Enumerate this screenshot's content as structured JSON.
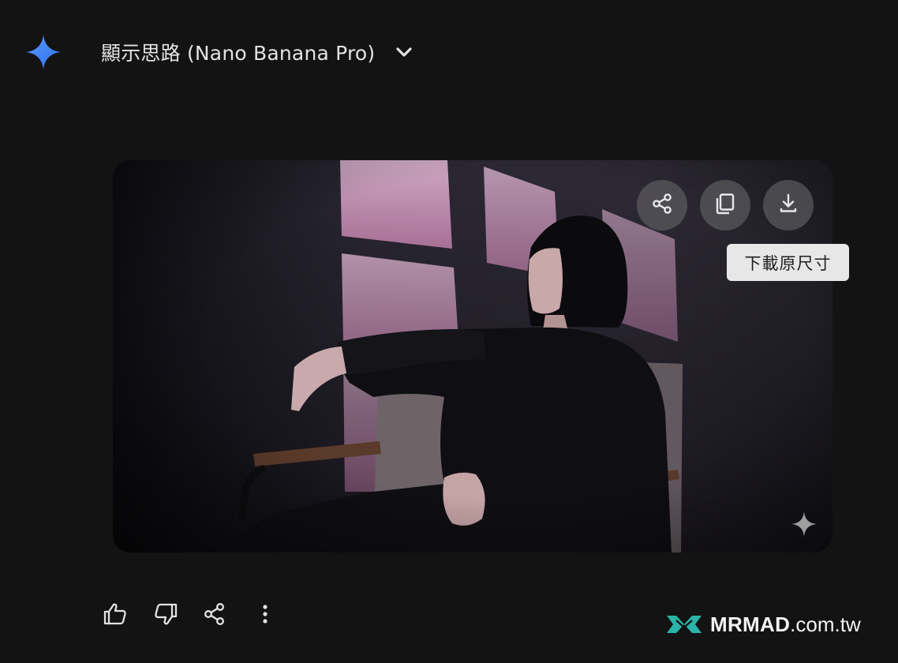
{
  "header": {
    "logo_icon": "gemini-sparkle-icon",
    "thinking_label": "顯示思路 (Nano Banana Pro)",
    "toggle_icon": "chevron-down-icon"
  },
  "image_card": {
    "buttons": [
      {
        "name": "share-image-button",
        "icon": "share-icon"
      },
      {
        "name": "copy-image-button",
        "icon": "copy-icon"
      },
      {
        "name": "download-image-button",
        "icon": "download-icon"
      }
    ],
    "tooltip": "下載原尺寸",
    "watermark_icon": "sparkle-icon"
  },
  "response_actions": [
    {
      "name": "good-response-button",
      "icon": "thumbs-up-icon"
    },
    {
      "name": "bad-response-button",
      "icon": "thumbs-down-icon"
    },
    {
      "name": "share-response-button",
      "icon": "share-icon"
    },
    {
      "name": "more-options-button",
      "icon": "more-vert-icon"
    }
  ],
  "site_watermark": {
    "brand": "MRMAD",
    "domain": ".com.tw"
  },
  "colors": {
    "background": "#131314",
    "text": "#e3e3e3",
    "gemini_blue": "#4a8cf7",
    "tooltip_bg": "#e7e7e7",
    "brand_teal": "#2bb3a8"
  }
}
